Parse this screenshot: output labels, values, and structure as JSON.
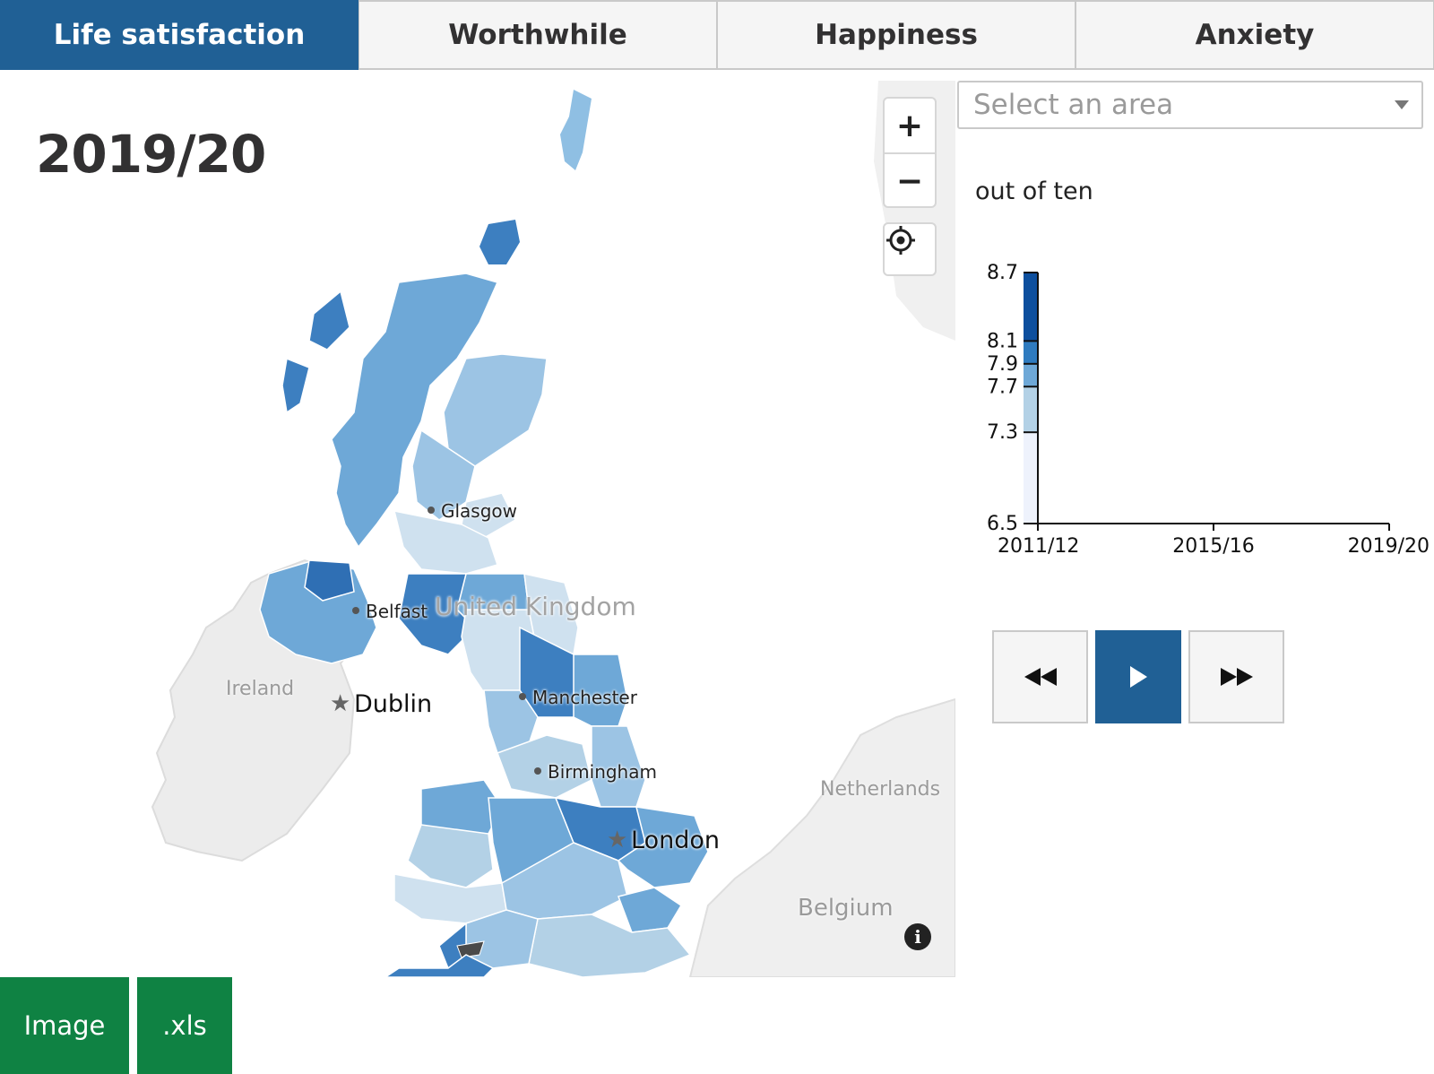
{
  "tabs": [
    {
      "label": "Life satisfaction",
      "active": true
    },
    {
      "label": "Worthwhile",
      "active": false
    },
    {
      "label": "Happiness",
      "active": false
    },
    {
      "label": "Anxiety",
      "active": false
    }
  ],
  "map": {
    "year": "2019/20",
    "labels": {
      "glasgow": "Glasgow",
      "belfast": "Belfast",
      "united_kingdom": "United Kingdom",
      "ireland": "Ireland",
      "dublin": "Dublin",
      "manchester": "Manchester",
      "birmingham": "Birmingham",
      "london": "London",
      "netherlands": "Netherlands",
      "belgium": "Belgium"
    },
    "zoom_in": "+",
    "zoom_out": "−",
    "icons": {
      "locate": "locate-icon",
      "info": "info-icon"
    },
    "info_glyph": "i",
    "colors": {
      "darkest": "#0d4f9e",
      "dark": "#2f7bbf",
      "mid": "#6ea8d7",
      "light": "#b3d1e6",
      "lightest": "#eef2fc",
      "no_data": "#4a4a4a",
      "basemap": "#e8e8e8"
    }
  },
  "area_select": {
    "placeholder": "Select an area"
  },
  "chart_data": {
    "type": "line",
    "ylabel": "out of ten",
    "y_ticks": [
      "8.7",
      "8.1",
      "7.9",
      "7.7",
      "7.3",
      "6.5"
    ],
    "ylim": [
      6.5,
      8.7
    ],
    "x_ticks": [
      "2011/12",
      "2015/16",
      "2019/20"
    ],
    "legend_bands": [
      {
        "from": 8.1,
        "to": 8.7,
        "color": "#0d4f9e"
      },
      {
        "from": 7.9,
        "to": 8.1,
        "color": "#2f7bbf"
      },
      {
        "from": 7.7,
        "to": 7.9,
        "color": "#6ea8d7"
      },
      {
        "from": 7.3,
        "to": 7.7,
        "color": "#b3d1e6"
      },
      {
        "from": 6.5,
        "to": 7.3,
        "color": "#eef2fc"
      }
    ],
    "series": []
  },
  "player": {
    "icons": {
      "back": "rewind-icon",
      "play": "play-icon",
      "forward": "fast-forward-icon"
    },
    "accent": "#206095"
  },
  "downloads": [
    {
      "label": "Image"
    },
    {
      "label": ".xls"
    }
  ],
  "download_color": "#0f8243"
}
